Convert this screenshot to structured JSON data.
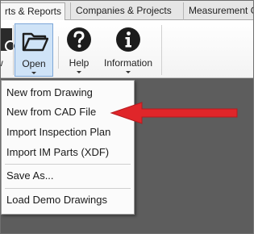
{
  "tabs": [
    {
      "label": "rts & Reports",
      "active": true
    },
    {
      "label": "Companies & Projects",
      "active": false
    },
    {
      "label": "Measurement G",
      "active": false
    }
  ],
  "ribbon": {
    "buttons": [
      {
        "label": "w",
        "icon": "new-document-icon"
      },
      {
        "label": "Open",
        "icon": "folder-open-icon"
      },
      {
        "label": "Help",
        "icon": "help-question-icon"
      },
      {
        "label": "Information",
        "icon": "info-icon"
      }
    ]
  },
  "menu": {
    "items": [
      {
        "label": "New from Drawing"
      },
      {
        "label": "New from CAD File"
      },
      {
        "label": "Import Inspection Plan"
      },
      {
        "label": "Import IM Parts (XDF)"
      },
      {
        "label": "Save As..."
      },
      {
        "label": "Load Demo Drawings"
      }
    ]
  },
  "annotation": {
    "icon": "red-arrow-icon",
    "color": "#e0262a"
  },
  "colors": {
    "workspace": "#5d5d5d",
    "pressed": "#cfe3f7",
    "accent": "#e0262a"
  }
}
